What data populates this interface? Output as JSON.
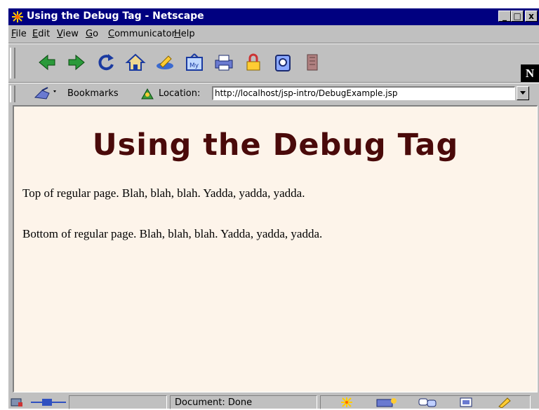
{
  "window": {
    "title": "Using the Debug Tag - Netscape",
    "controls": {
      "minimize": "_",
      "maximize": "□",
      "close": "x"
    }
  },
  "menu": {
    "items": [
      {
        "label": "File",
        "key": "F"
      },
      {
        "label": "Edit",
        "key": "E"
      },
      {
        "label": "View",
        "key": "V"
      },
      {
        "label": "Go",
        "key": "G"
      },
      {
        "label": "Communicator",
        "key": "C"
      },
      {
        "label": "Help",
        "key": "H"
      }
    ]
  },
  "toolbar": {
    "buttons": [
      "back-icon",
      "forward-icon",
      "reload-icon",
      "home-icon",
      "search-icon",
      "guide-icon",
      "print-icon",
      "security-icon",
      "shop-icon",
      "stop-icon"
    ],
    "logo": "N"
  },
  "location_bar": {
    "bookmarks_label": "Bookmarks",
    "location_label": "Location:",
    "url": "http://localhost/jsp-intro/DebugExample.jsp"
  },
  "page": {
    "heading": "Using the Debug Tag",
    "paragraphs": [
      "Top of regular page. Blah, blah, blah. Yadda, yadda, yadda.",
      "Bottom of regular page. Blah, blah, blah. Yadda, yadda, yadda."
    ]
  },
  "status_bar": {
    "text": "Document: Done",
    "components": [
      "navigator-icon",
      "mail-icon",
      "discussion-icon",
      "composer-icon"
    ]
  },
  "colors": {
    "title_bar": "#000080",
    "content_bg": "#fdf4ea",
    "heading": "#4a0a0a"
  }
}
